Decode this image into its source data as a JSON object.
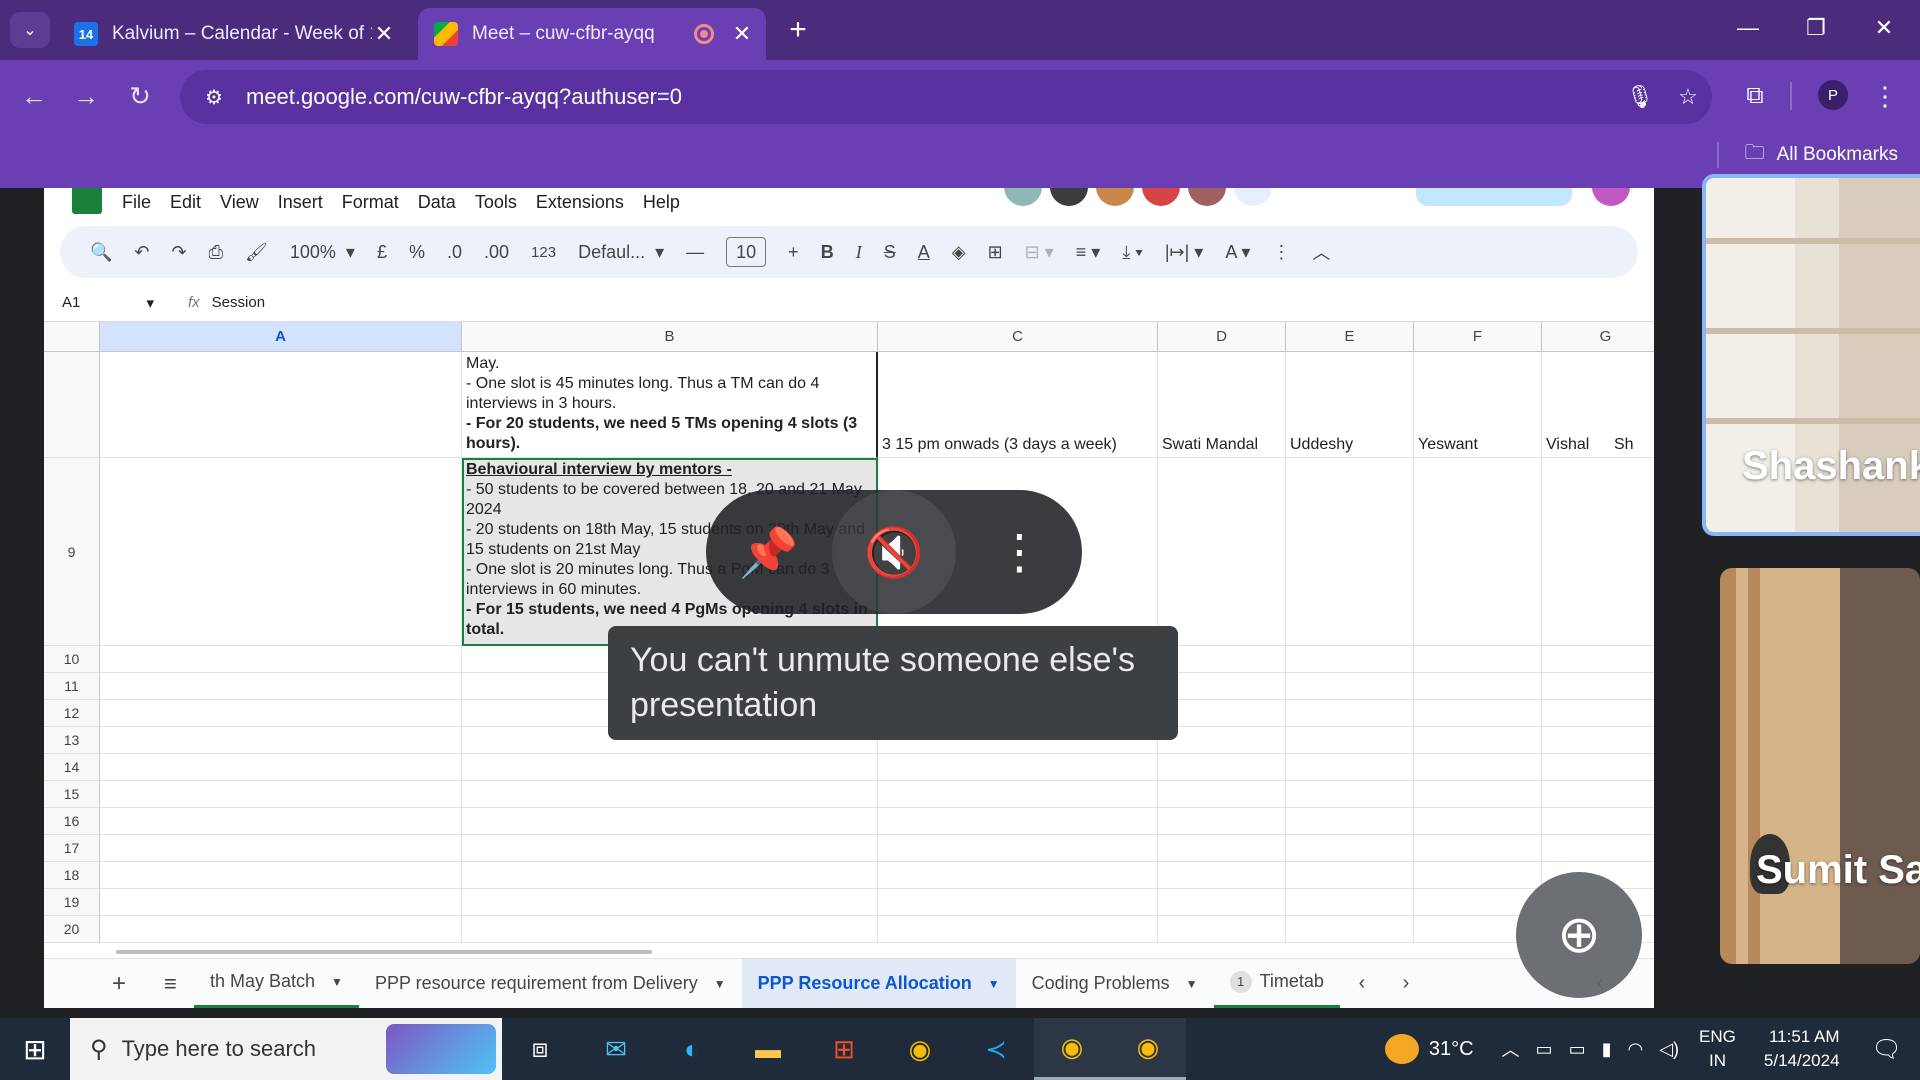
{
  "browser": {
    "tabs": [
      {
        "title": "Kalvium – Calendar - Week of 1",
        "favicon": "calendar-icon",
        "active": false
      },
      {
        "title": "Meet – cuw-cfbr-ayqq",
        "favicon": "meet-icon",
        "active": true
      }
    ],
    "url": "meet.google.com/cuw-cfbr-ayqq?authuser=0",
    "profile_initial": "P",
    "bookmarks_label": "All Bookmarks"
  },
  "sheets": {
    "menu": [
      "File",
      "Edit",
      "View",
      "Insert",
      "Format",
      "Data",
      "Tools",
      "Extensions",
      "Help"
    ],
    "toolbar": {
      "zoom": "100%",
      "currency": "£",
      "percent": "%",
      "dec_decrease": ".0",
      "dec_increase": ".00",
      "number_format": "123",
      "font": "Defaul...",
      "font_size": "10"
    },
    "name_box": "A1",
    "formula_value": "Session",
    "columns": [
      "A",
      "B",
      "C",
      "D",
      "E",
      "F",
      "G"
    ],
    "row_numbers": [
      "9",
      "10",
      "11",
      "12",
      "13",
      "14",
      "15",
      "16",
      "17",
      "18",
      "19",
      "20"
    ],
    "row8": {
      "b_line1": "May.",
      "b_line2": "- One slot is 45 minutes long. Thus a TM can do 4 interviews in 3 hours.",
      "b_bold": "- For 20 students, we need 5 TMs opening 4 slots (3 hours).",
      "c": "3 15 pm onwads (3 days a week)",
      "d": "Swati Mandal",
      "e": "Uddeshy",
      "f": "Yeswant",
      "g": "Vishal",
      "h": "Sh"
    },
    "row9": {
      "b_title": "Behavioural interview by mentors -",
      "b_line1": "- 50 students to be covered between 18, 20 and 21 May 2024",
      "b_line2": "- 20 students on 18th May, 15 students on 20th May and 15 students on 21st May",
      "b_line3": "- One slot is 20 minutes long. Thus a PgM can do 3 interviews in 60 minutes.",
      "b_bold": "- For 15 students, we need 4 PgMs opening 4 slots in total."
    },
    "sheet_tabs": [
      {
        "label": "th May Batch"
      },
      {
        "label": "PPP resource requirement from Delivery"
      },
      {
        "label": "PPP Resource Allocation"
      },
      {
        "label": "Coding Problems"
      },
      {
        "label": "Timetab",
        "badge": "1"
      }
    ]
  },
  "meet": {
    "toast": "You can't unmute someone else's presentation",
    "participants": [
      {
        "name": "Shashank"
      },
      {
        "name": "Sumit Sa"
      }
    ]
  },
  "taskbar": {
    "search_placeholder": "Type here to search",
    "temperature": "31°C",
    "lang_top": "ENG",
    "lang_bottom": "IN",
    "time": "11:51 AM",
    "date": "5/14/2024"
  },
  "colors": {
    "tabbar": "#4a2b7c",
    "toolbar": "#6a3fb3",
    "sheets_green": "#188038",
    "sheets_blue": "#0b57d0"
  }
}
